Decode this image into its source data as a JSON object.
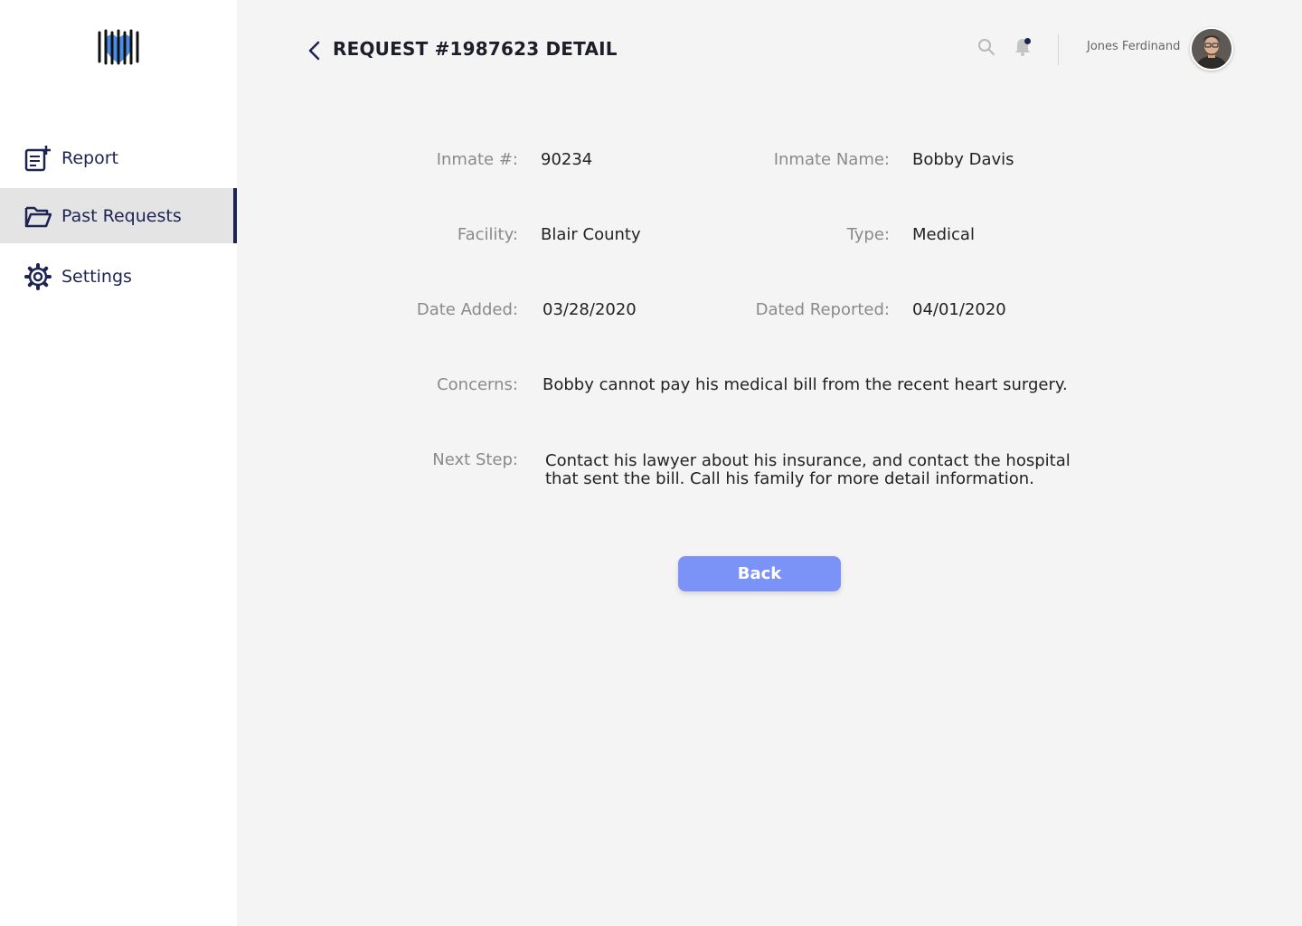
{
  "nav": {
    "items": [
      {
        "label": "Report",
        "icon": "report-add-icon",
        "active": false
      },
      {
        "label": "Past Requests",
        "icon": "folder-open-icon",
        "active": true
      },
      {
        "label": "Settings",
        "icon": "gear-icon",
        "active": false
      }
    ]
  },
  "header": {
    "title": "REQUEST #1987623 DETAIL",
    "user_name": "Jones Ferdinand"
  },
  "detail": {
    "inmate_number_label": "Inmate #:",
    "inmate_number": "90234",
    "inmate_name_label": "Inmate Name:",
    "inmate_name": "Bobby Davis",
    "facility_label": "Facility:",
    "facility": "Blair County",
    "type_label": "Type:",
    "type": "Medical",
    "date_added_label": "Date Added:",
    "date_added": "03/28/2020",
    "date_reported_label": "Dated Reported:",
    "date_reported": "04/01/2020",
    "concerns_label": "Concerns:",
    "concerns": "Bobby cannot pay his medical bill from the recent heart surgery.",
    "next_step_label": "Next Step:",
    "next_step": "Contact his lawyer about his insurance, and contact the hospital that sent the bill. Call his family for more detail information."
  },
  "actions": {
    "back_label": "Back"
  },
  "colors": {
    "accent": "#7b93f7",
    "navy": "#1d2454",
    "logo_heart": "#4a8de6",
    "background": "#f4f4f4"
  }
}
